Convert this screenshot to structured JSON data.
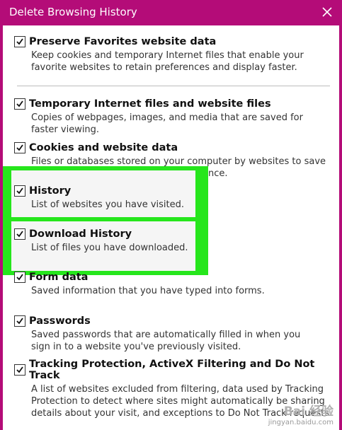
{
  "dialog": {
    "title": "Delete Browsing History",
    "close_icon": "close-icon"
  },
  "options": [
    {
      "label": "Preserve Favorites website data",
      "description": "Keep cookies and temporary Internet files that enable your favorite websites to retain preferences and display faster.",
      "checked": true
    },
    {
      "label": "Temporary Internet files and website files",
      "description": "Copies of webpages, images, and media that are saved for faster viewing.",
      "checked": true
    },
    {
      "label": "Cookies and website data",
      "description": "Files or databases stored on your computer by websites to save",
      "description_partial": "ance.",
      "checked": true
    },
    {
      "label": "History",
      "description": "List of websites you have visited.",
      "checked": true
    },
    {
      "label": "Download History",
      "description": "List of files you have downloaded.",
      "checked": true
    },
    {
      "label": "Form data",
      "description": "Saved information that you have typed into forms.",
      "checked": true
    },
    {
      "label": "Passwords",
      "description": "Saved passwords that are automatically filled in when you sign in to a website you've previously visited.",
      "checked": true
    },
    {
      "label": "Tracking Protection, ActiveX Filtering and Do Not Track",
      "description": "A list of websites excluded from filtering, data used by Tracking Protection to detect where sites might automatically be sharing details about your visit, and exceptions to Do Not Track requests.",
      "checked": true
    }
  ],
  "watermark": {
    "brand": "Bai 经验",
    "url": "jingyan.baidu.com"
  },
  "colors": {
    "titlebar": "#b40c78",
    "highlight": "#26e61c"
  }
}
